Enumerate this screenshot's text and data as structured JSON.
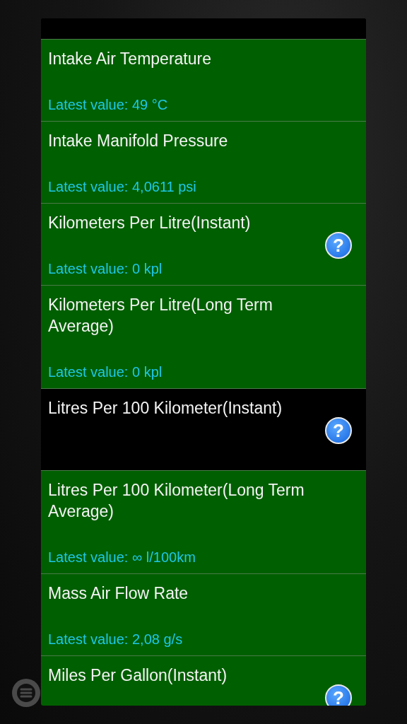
{
  "sensors": [
    {
      "title": "Intake Air Temperature",
      "value": "Latest value: 49 °C",
      "selected": true
    },
    {
      "title": "Intake Manifold Pressure",
      "value": "Latest value: 4,0611 psi",
      "selected": true
    },
    {
      "title": "Kilometers Per Litre(Instant)",
      "value": "Latest value: 0 kpl",
      "selected": true,
      "help": "?"
    },
    {
      "title": "Kilometers Per Litre(Long Term Average)",
      "value": "Latest value: 0 kpl",
      "selected": true
    },
    {
      "title": "Litres Per 100 Kilometer(Instant)",
      "selected": false,
      "help": "?"
    },
    {
      "title": "Litres Per 100 Kilometer(Long Term Average)",
      "value": "Latest value: ∞ l/100km",
      "selected": true
    },
    {
      "title": "Mass Air Flow Rate",
      "value": "Latest value: 2,08 g/s",
      "selected": true
    },
    {
      "title": "Miles Per Gallon(Instant)",
      "selected": true,
      "help": "?"
    }
  ]
}
